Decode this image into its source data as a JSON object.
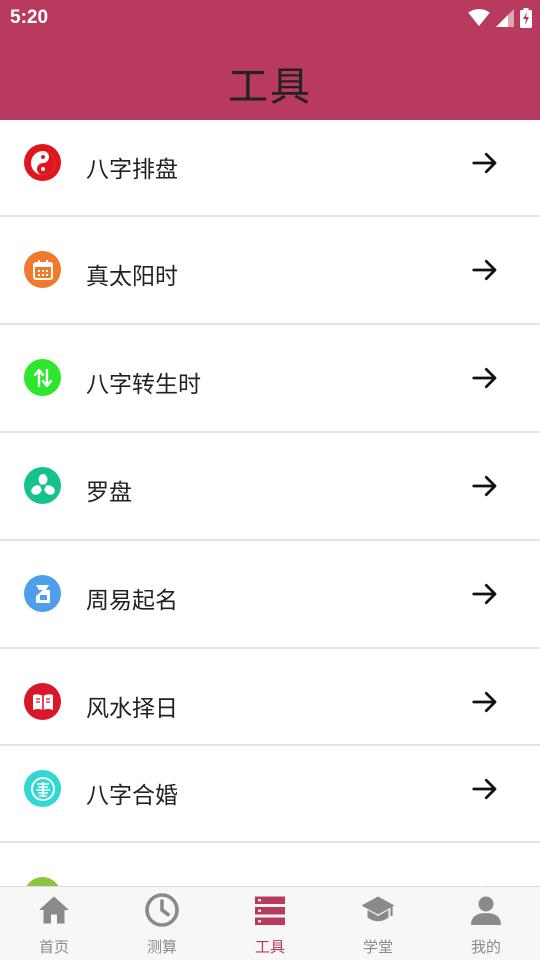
{
  "status_bar": {
    "time": "5:20"
  },
  "header": {
    "title": "工具"
  },
  "tools": [
    {
      "label": "八字排盘",
      "icon": "yin-yang-icon",
      "color": "#e0161d"
    },
    {
      "label": "真太阳时",
      "icon": "calendar-icon",
      "color": "#f0792b"
    },
    {
      "label": "八字转生时",
      "icon": "swap-arrows-icon",
      "color": "#2ee62e"
    },
    {
      "label": "罗盘",
      "icon": "fan-icon",
      "color": "#13c28c"
    },
    {
      "label": "周易起名",
      "icon": "name-badge-icon",
      "color": "#4d9fea"
    },
    {
      "label": "风水择日",
      "icon": "open-book-icon",
      "color": "#d9172a"
    },
    {
      "label": "八字合婚",
      "icon": "double-happiness-icon",
      "color": "#2fd8d2"
    }
  ],
  "tab_bar": {
    "tabs": [
      {
        "label": "首页",
        "icon": "home-icon"
      },
      {
        "label": "测算",
        "icon": "clock-icon"
      },
      {
        "label": "工具",
        "icon": "list-icon",
        "active": true
      },
      {
        "label": "学堂",
        "icon": "graduation-cap-icon"
      },
      {
        "label": "我的",
        "icon": "person-icon"
      }
    ]
  },
  "colors": {
    "primary": "#b83a5e",
    "divider": "#e3e3e3",
    "tab_inactive": "#8a8a8a"
  }
}
